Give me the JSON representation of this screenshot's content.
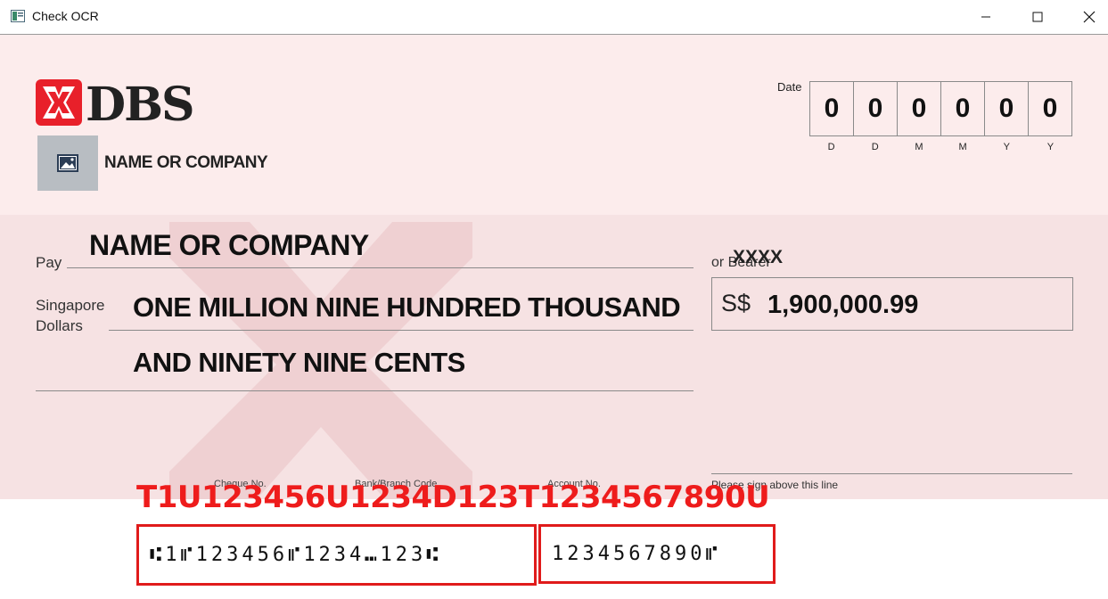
{
  "window": {
    "title": "Check OCR",
    "buttons": [
      "minimize",
      "maximize",
      "close"
    ]
  },
  "cheque": {
    "bank_name": "DBS",
    "company_label": "NAME OR COMPANY",
    "date_label": "Date",
    "date_digits": [
      "0",
      "0",
      "0",
      "0",
      "0",
      "0"
    ],
    "date_hints": [
      "D",
      "D",
      "M",
      "M",
      "Y",
      "Y"
    ],
    "pay_label": "Pay",
    "payee": "NAME OR COMPANY",
    "bearer_label": "or Bearer",
    "bearer_value": "XXXX",
    "currency_label_line1": "Singapore",
    "currency_label_line2": "Dollars",
    "amount_words_line1": "ONE MILLION NINE HUNDRED THOUSAND",
    "amount_words_line2": "AND NINETY NINE CENTS",
    "currency_symbol": "S$",
    "amount": "1,900,000.99",
    "cheque_no_label": "Cheque No.",
    "bank_branch_label": "Bank/Branch Code",
    "account_no_label": "Account No.",
    "signature_label": "Please sign above this line"
  },
  "ocr": {
    "result_text": "T1U123456U1234D123T1234567890U",
    "micr_left": "⑆1⑈123456⑈1234⑉123⑆",
    "micr_right": "1234567890⑈"
  },
  "colors": {
    "cheque_bg": "#fcecec",
    "band_bg": "#f6e2e3",
    "dbs_red": "#e8202a",
    "ocr_red": "#ee1c1c"
  }
}
